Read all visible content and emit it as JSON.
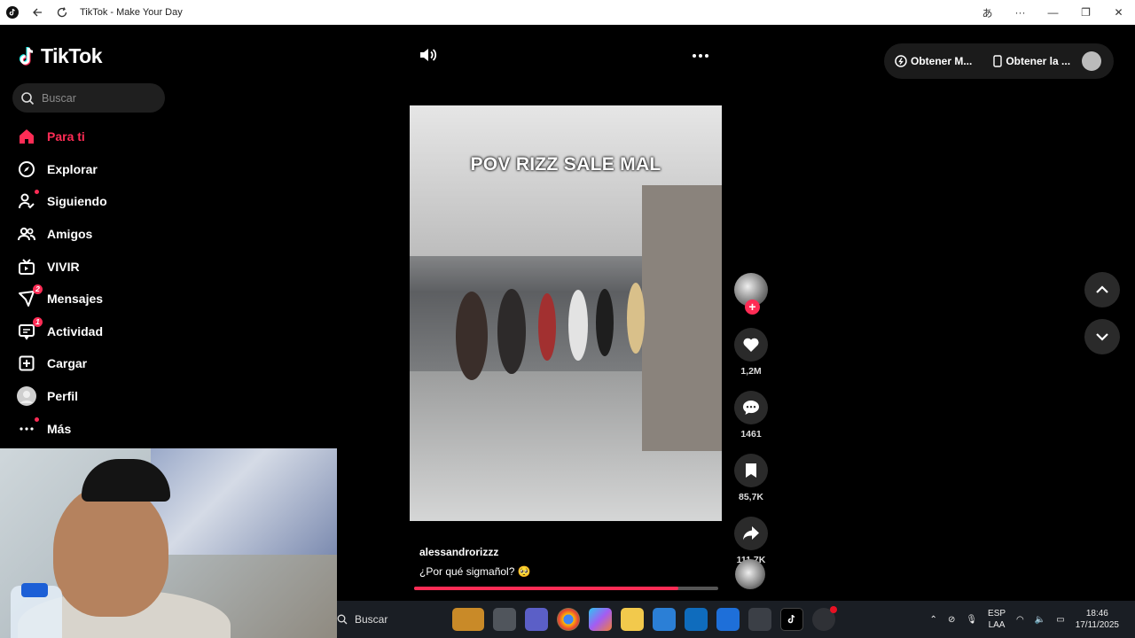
{
  "window": {
    "title": "TikTok - Make Your Day"
  },
  "sidebar": {
    "logo": "TikTok",
    "search_placeholder": "Buscar",
    "items": [
      {
        "label": "Para ti",
        "icon": "home-icon",
        "active": true
      },
      {
        "label": "Explorar",
        "icon": "compass-icon"
      },
      {
        "label": "Siguiendo",
        "icon": "following-icon",
        "dot": true
      },
      {
        "label": "Amigos",
        "icon": "friends-icon"
      },
      {
        "label": "VIVIR",
        "icon": "live-icon"
      },
      {
        "label": "Mensajes",
        "icon": "messages-icon",
        "badge": "2"
      },
      {
        "label": "Actividad",
        "icon": "activity-icon",
        "badge": "1"
      },
      {
        "label": "Cargar",
        "icon": "upload-icon"
      },
      {
        "label": "Perfil",
        "icon": "profile-avatar-icon"
      },
      {
        "label": "Más",
        "icon": "more-dots-icon",
        "dot": true
      }
    ]
  },
  "video": {
    "caption": "POV RIZZ SALE MAL",
    "username": "alessandrorizzz",
    "description": "¿Por qué sigmañol?",
    "description_emoji": "🥺",
    "progress_fraction": 0.87
  },
  "actions": {
    "likes": "1,2M",
    "comments": "1461",
    "saves": "85,7K",
    "shares": "111,7K"
  },
  "topbar": {
    "get_app_1": "Obtener M...",
    "get_app_2": "Obtener la ..."
  },
  "taskbar": {
    "search_label": "Buscar",
    "lang_line1": "ESP",
    "lang_line2": "LAA",
    "time": "18:46",
    "date": "17/11/2025"
  },
  "colors": {
    "accent": "#fe2c55",
    "background": "#000000"
  }
}
